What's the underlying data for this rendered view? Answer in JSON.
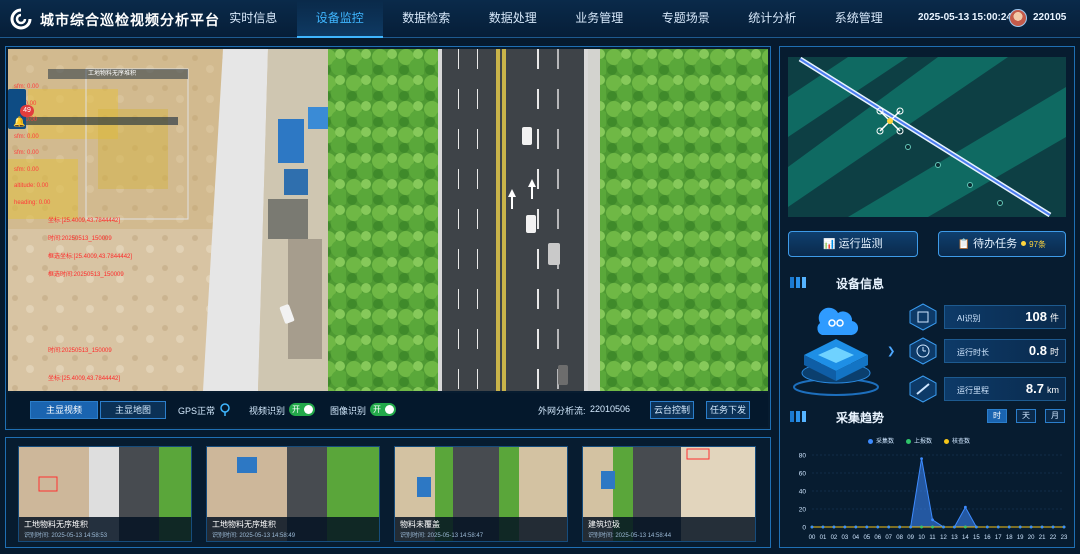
{
  "header": {
    "title": "城市综合巡检视频分析平台",
    "nav": [
      "实时信息",
      "设备监控",
      "数据检索",
      "数据处理",
      "业务管理",
      "专题场景",
      "统计分析",
      "系统管理"
    ],
    "active_nav": "设备监控",
    "datetime": "2025-05-13 15:00:24",
    "user_id": "220105"
  },
  "alerts": {
    "badge_count": "49"
  },
  "video_overlay": {
    "box_label": "工地物料无序堆积",
    "lines": [
      "sfm: 0.00",
      "scl: 0.00",
      "dtc: 0.00",
      "sfm: 0.00",
      "sfm: 0.00",
      "sfm: 0.00",
      "altitude: 0.00",
      "heading: 0.00"
    ],
    "red_lines": [
      "坐标:[25.4009,43.7844442]",
      "时间:20250513_150009",
      "框选坐标:[25.4009,43.7844442]",
      "框选时间:20250513_150009",
      "时间:20250513_150009",
      "坐标:[25.4009,43.7844442]"
    ]
  },
  "controls": {
    "main_video": "主显视频",
    "main_map": "主显地图",
    "gps_label": "GPS正常",
    "video_recog_label": "视频识别",
    "image_recog_label": "图像识别",
    "toggle_on": "开",
    "stream_label": "外网分析流:",
    "stream_id": "22010506",
    "ptz_btn": "云台控制",
    "task_btn": "任务下发"
  },
  "thumbnails": [
    {
      "title": "工地物料无序堆积",
      "time": "识别时间: 2025-05-13 14:58:53"
    },
    {
      "title": "工地物料无序堆积",
      "time": "识别时间: 2025-05-13 14:58:49"
    },
    {
      "title": "物料未覆盖",
      "time": "识别时间: 2025-05-13 14:58:47"
    },
    {
      "title": "建筑垃圾",
      "time": "识别时间: 2025-05-13 14:58:44"
    }
  ],
  "right": {
    "run_monitor": "运行监测",
    "pending_tasks": "待办任务",
    "pending_count": "97条",
    "device_info_title": "设备信息",
    "stats": [
      {
        "label": "AI识别",
        "value": "108",
        "unit": "件",
        "icon": "scan-icon"
      },
      {
        "label": "运行时长",
        "value": "0.8",
        "unit": "时",
        "icon": "clock-icon"
      },
      {
        "label": "运行里程",
        "value": "8.7",
        "unit": "km",
        "icon": "ruler-icon"
      }
    ],
    "trend_title": "采集趋势",
    "ranges": [
      "时",
      "天",
      "月"
    ],
    "active_range": "时"
  },
  "chart_data": {
    "type": "area",
    "x": [
      "00",
      "01",
      "02",
      "03",
      "04",
      "05",
      "06",
      "07",
      "08",
      "09",
      "10",
      "11",
      "12",
      "13",
      "14",
      "15",
      "16",
      "17",
      "18",
      "19",
      "20",
      "21",
      "22",
      "23"
    ],
    "series": [
      {
        "name": "采集数",
        "color": "#3d8bff",
        "values": [
          0,
          0,
          0,
          0,
          0,
          0,
          0,
          0,
          0,
          0,
          76,
          8,
          0,
          0,
          22,
          0,
          0,
          0,
          0,
          0,
          0,
          0,
          0,
          0
        ]
      },
      {
        "name": "上报数",
        "color": "#2fc46a",
        "values": [
          0,
          0,
          0,
          0,
          0,
          0,
          0,
          0,
          0,
          0,
          0,
          0,
          0,
          0,
          0,
          0,
          0,
          0,
          0,
          0,
          0,
          0,
          0,
          0
        ]
      },
      {
        "name": "核查数",
        "color": "#f5c518",
        "values": [
          0,
          0,
          0,
          0,
          0,
          0,
          0,
          0,
          0,
          0,
          0,
          0,
          0,
          0,
          0,
          0,
          0,
          0,
          0,
          0,
          0,
          0,
          0,
          0
        ]
      }
    ],
    "yticks": [
      0,
      20,
      40,
      60,
      80
    ],
    "ylim": [
      0,
      80
    ],
    "grid": true,
    "legend": "top"
  }
}
